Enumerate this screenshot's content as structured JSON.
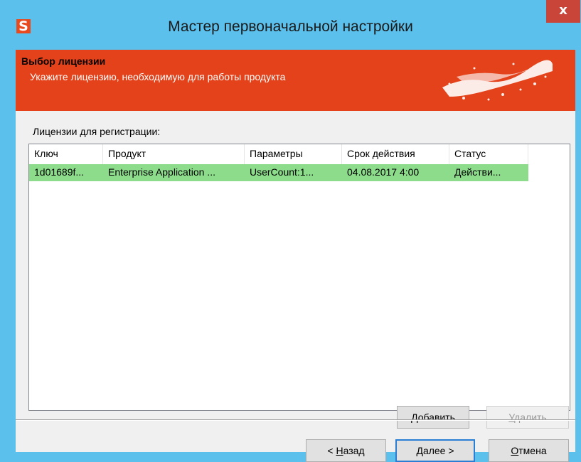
{
  "window": {
    "title": "Мастер первоначальной настройки",
    "app_icon_letter": "S",
    "close_glyph": "x"
  },
  "banner": {
    "title": "Выбор лицензии",
    "subtitle": "Укажите лицензию, необходимую для работы продукта"
  },
  "licenses": {
    "group_label": "Лицензии для регистрации:",
    "columns": [
      "Ключ",
      "Продукт",
      "Параметры",
      "Срок действия",
      "Статус"
    ],
    "rows": [
      {
        "key": "1d01689f...",
        "product": "Enterprise Application ...",
        "params": "UserCount:1...",
        "expires": "04.08.2017 4:00",
        "status": "Действи..."
      }
    ]
  },
  "buttons": {
    "add": {
      "mnemonic": "Д",
      "rest": "обавить"
    },
    "remove": {
      "mnemonic": "У",
      "rest": "далить"
    },
    "back": {
      "prefix": "< ",
      "mnemonic": "Н",
      "rest": "азад"
    },
    "next": {
      "mnemonic": "Д",
      "rest": "алее >"
    },
    "cancel": {
      "mnemonic": "О",
      "rest": "тмена"
    }
  },
  "colors": {
    "banner": "#e3421a",
    "titlebar": "#5bc0eb",
    "selected_row": "#8cdc8c",
    "close": "#c9453a"
  }
}
